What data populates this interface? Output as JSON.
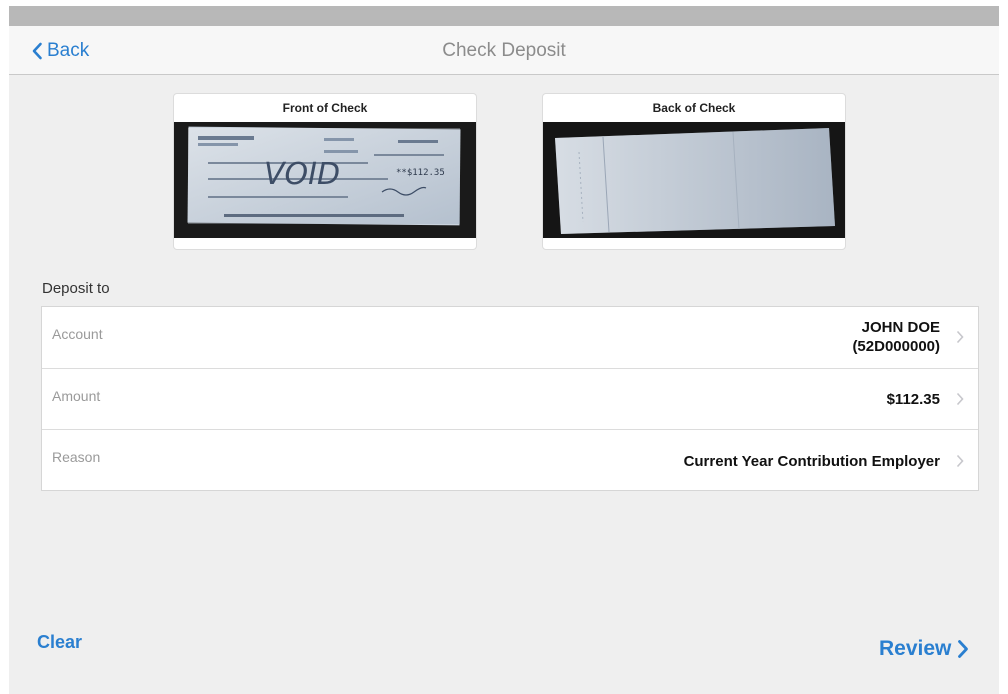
{
  "nav": {
    "back_label": "Back",
    "title": "Check Deposit"
  },
  "checks": {
    "front_label": "Front of Check",
    "back_label": "Back of Check",
    "front_amount_text": "**$112.35",
    "front_void_text": "VOID"
  },
  "deposit": {
    "section_title": "Deposit to",
    "rows": [
      {
        "label": "Account",
        "value_line1": "JOHN DOE",
        "value_line2": "(52D000000)"
      },
      {
        "label": "Amount",
        "value": "$112.35"
      },
      {
        "label": "Reason",
        "value": "Current Year Contribution Employer"
      }
    ]
  },
  "footer": {
    "clear_label": "Clear",
    "review_label": "Review"
  },
  "colors": {
    "accent": "#2a7fd0",
    "background": "#efefef",
    "navbar": "#f7f7f7",
    "statusbar": "#b8b8b8"
  }
}
